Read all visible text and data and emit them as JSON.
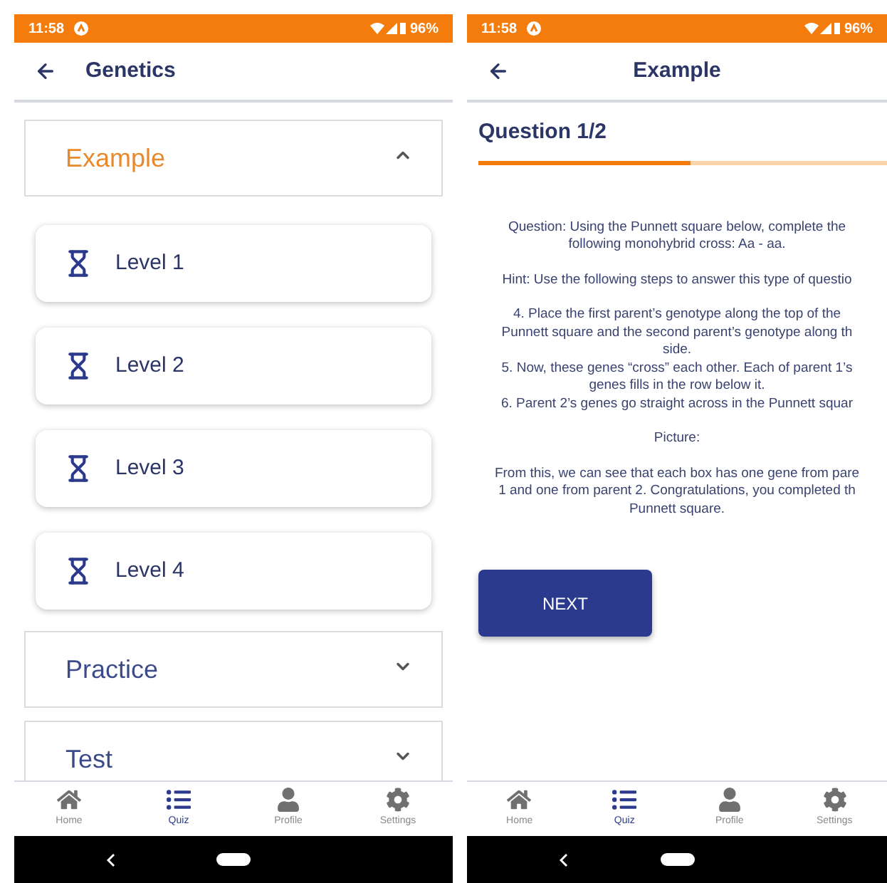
{
  "screens": [
    {
      "status_bar": {
        "time": "11:58",
        "battery": "96%"
      },
      "header": {
        "title": "Genetics",
        "centered": false
      },
      "kind": "topics",
      "sections": [
        {
          "title": "Example",
          "expanded": true,
          "items": [
            {
              "label": "Level 1"
            },
            {
              "label": "Level 2"
            },
            {
              "label": "Level 3"
            },
            {
              "label": "Level 4"
            }
          ]
        },
        {
          "title": "Practice",
          "expanded": false
        },
        {
          "title": "Test",
          "expanded": false
        }
      ],
      "nav": [
        {
          "label": "Home",
          "selected": false
        },
        {
          "label": "Quiz",
          "selected": true
        },
        {
          "label": "Profile",
          "selected": false
        },
        {
          "label": "Settings",
          "selected": false
        }
      ]
    },
    {
      "status_bar": {
        "time": "11:58",
        "battery": "96%"
      },
      "header": {
        "title": "Example",
        "centered": true
      },
      "kind": "question",
      "question": {
        "title": "Question 1/2",
        "level": 0.52,
        "paragraphs": [
          [
            "Question: Using the Punnett square below, complete the",
            "following monohybrid cross: Aa - aa."
          ],
          [
            "Hint: Use the following steps to answer this type of questio"
          ],
          [
            "4. Place the first parent’s genotype along the top of the",
            "Punnett square and the second parent’s genotype along th",
            "side.",
            "5. Now, these genes “cross” each other. Each of parent 1’s",
            "genes fills in the row below it.",
            "6. Parent 2’s genes go straight across in the Punnett squar"
          ],
          [
            "Picture:"
          ],
          [
            "From this, we can see that each box has one gene from pare",
            "1 and one from parent 2. Congratulations, you completed th",
            "Punnett square."
          ]
        ],
        "button": "NEXT"
      },
      "nav": [
        {
          "label": "Home",
          "selected": false
        },
        {
          "label": "Quiz",
          "selected": true
        },
        {
          "label": "Profile",
          "selected": false
        },
        {
          "label": "Settings",
          "selected": false
        }
      ]
    }
  ]
}
